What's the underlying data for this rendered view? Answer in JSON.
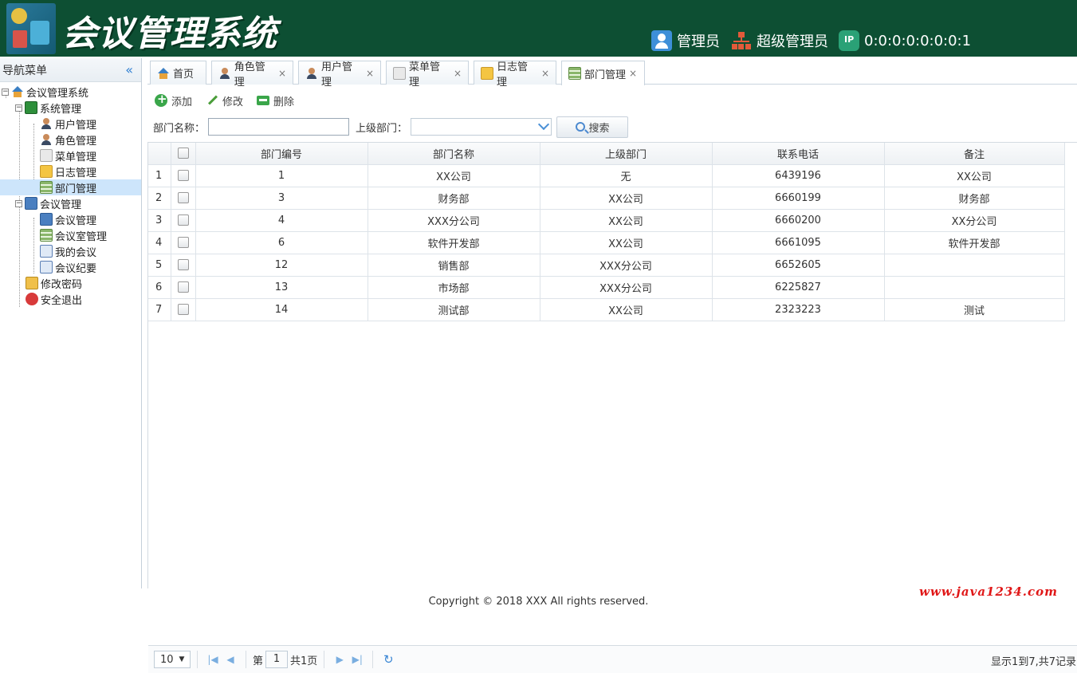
{
  "header": {
    "title": "会议管理系统",
    "role_label": "管理员",
    "account_label": "超级管理员",
    "ip_label": "0:0:0:0:0:0:0:1"
  },
  "nav": {
    "title": "导航菜单",
    "collapse_icon": "double-chevron-left-icon",
    "root": "会议管理系统",
    "groups": [
      {
        "label": "系统管理",
        "items": [
          "用户管理",
          "角色管理",
          "菜单管理",
          "日志管理",
          "部门管理"
        ]
      },
      {
        "label": "会议管理",
        "items": [
          "会议管理",
          "会议室管理",
          "我的会议",
          "会议纪要"
        ]
      }
    ],
    "extra": [
      "修改密码",
      "安全退出"
    ],
    "selected": "部门管理"
  },
  "tabs": [
    "首页",
    "角色管理",
    "用户管理",
    "菜单管理",
    "日志管理",
    "部门管理"
  ],
  "tab_close": "×",
  "toolbar": {
    "add": "添加",
    "edit": "修改",
    "delete": "删除"
  },
  "search": {
    "name_label": "部门名称：",
    "name_value": "",
    "parent_label": "上级部门：",
    "parent_value": "",
    "button": "搜索"
  },
  "grid": {
    "columns": [
      "部门编号",
      "部门名称",
      "上级部门",
      "联系电话",
      "备注"
    ],
    "rows": [
      [
        "1",
        "XX公司",
        "无",
        "6439196",
        "XX公司"
      ],
      [
        "3",
        "财务部",
        "XX公司",
        "6660199",
        "财务部"
      ],
      [
        "4",
        "XXX分公司",
        "XX公司",
        "6660200",
        "XX分公司"
      ],
      [
        "6",
        "软件开发部",
        "XX公司",
        "6661095",
        "软件开发部"
      ],
      [
        "12",
        "销售部",
        "XXX分公司",
        "6652605",
        ""
      ],
      [
        "13",
        "市场部",
        "XXX分公司",
        "6225827",
        ""
      ],
      [
        "14",
        "测试部",
        "XX公司",
        "2323223",
        "测试"
      ]
    ]
  },
  "pager": {
    "page_size": "10",
    "page_prefix": "第",
    "page_number": "1",
    "page_suffix": "共1页",
    "info": "显示1到7,共7记录"
  },
  "footer": "Copyright © 2018 XXX All rights reserved.",
  "watermark": "www.java1234.com",
  "colors": {
    "header_bg": "#0d4f33",
    "selected_bg": "#cde5fb",
    "watermark": "#e01818"
  }
}
